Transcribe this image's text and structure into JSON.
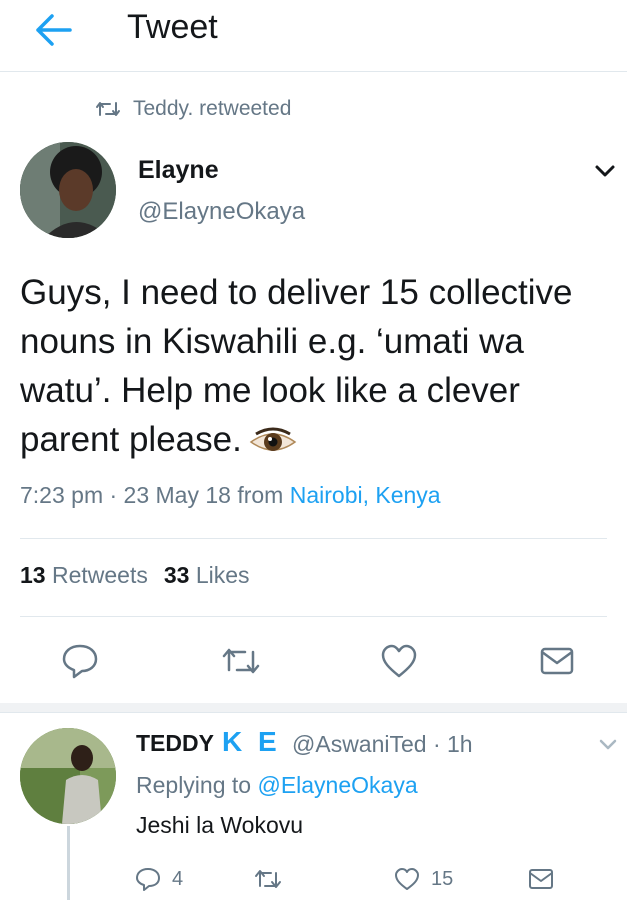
{
  "header": {
    "title": "Tweet"
  },
  "retweet_context": {
    "text": "Teddy. retweeted"
  },
  "tweet": {
    "author_name": "Elayne",
    "author_handle": "@ElayneOkaya",
    "text": "Guys, I need to deliver 15 collective nouns in Kiswahili e.g. ‘umati wa watu’. Help me look like a clever parent please.",
    "time_date": "7:23 pm · 23 May 18 from ",
    "location": "Nairobi, Kenya",
    "retweets_count": "13",
    "retweets_label": "Retweets",
    "likes_count": "33",
    "likes_label": "Likes"
  },
  "reply": {
    "author_name": "TEDDY",
    "author_suffix": "K E",
    "author_handle": "@AswaniTed",
    "time": " · 1h",
    "replying_prefix": "Replying to ",
    "replying_to": "@ElayneOkaya",
    "text": "Jeshi la Wokovu",
    "reply_count": "4",
    "like_count": "15"
  },
  "icons": {
    "back": "arrow-left-icon",
    "retweet": "retweet-icon",
    "caret": "chevron-down-icon",
    "reply": "reply-icon",
    "like": "heart-icon",
    "share": "envelope-icon",
    "emoji": "eye-emoji"
  },
  "colors": {
    "accent": "#1da1f2",
    "secondary_text": "#657786",
    "primary_text": "#14171a"
  }
}
